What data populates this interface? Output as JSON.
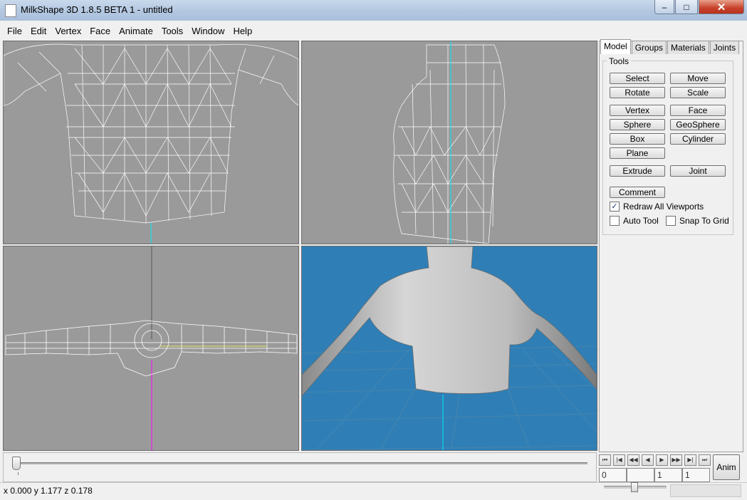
{
  "window": {
    "title": "MilkShape 3D 1.8.5 BETA 1 - untitled",
    "minimize": "‒",
    "maximize": "□",
    "close": "✕"
  },
  "menu": [
    "File",
    "Edit",
    "Vertex",
    "Face",
    "Animate",
    "Tools",
    "Window",
    "Help"
  ],
  "tabs": [
    "Model",
    "Groups",
    "Materials",
    "Joints"
  ],
  "active_tab": "Model",
  "tools": {
    "legend": "Tools",
    "buttons": {
      "select": "Select",
      "move": "Move",
      "rotate": "Rotate",
      "scale": "Scale",
      "vertex": "Vertex",
      "face": "Face",
      "sphere": "Sphere",
      "geosphere": "GeoSphere",
      "box": "Box",
      "cylinder": "Cylinder",
      "plane": "Plane",
      "extrude": "Extrude",
      "joint": "Joint",
      "comment": "Comment"
    },
    "checks": {
      "redraw_all": {
        "label": "Redraw All Viewports",
        "checked": true
      },
      "auto_tool": {
        "label": "Auto Tool",
        "checked": false
      },
      "snap_grid": {
        "label": "Snap To Grid",
        "checked": false
      }
    }
  },
  "anim": {
    "nav": [
      "⏮",
      "|◀",
      "◀◀",
      "◀",
      "▶",
      "▶▶",
      "▶|",
      "⏭"
    ],
    "fields": [
      "0",
      "",
      "1",
      "1"
    ],
    "anim_label": "Anim"
  },
  "status": {
    "coords": "x 0.000 y 1.177 z 0.178"
  },
  "colors": {
    "viewport_gray": "#9a9a9a",
    "perspective_bg": "#2f7fb6",
    "wire": "#ffffff",
    "axis_cyan": "#00e5ff",
    "axis_magenta": "#ff00ff"
  }
}
